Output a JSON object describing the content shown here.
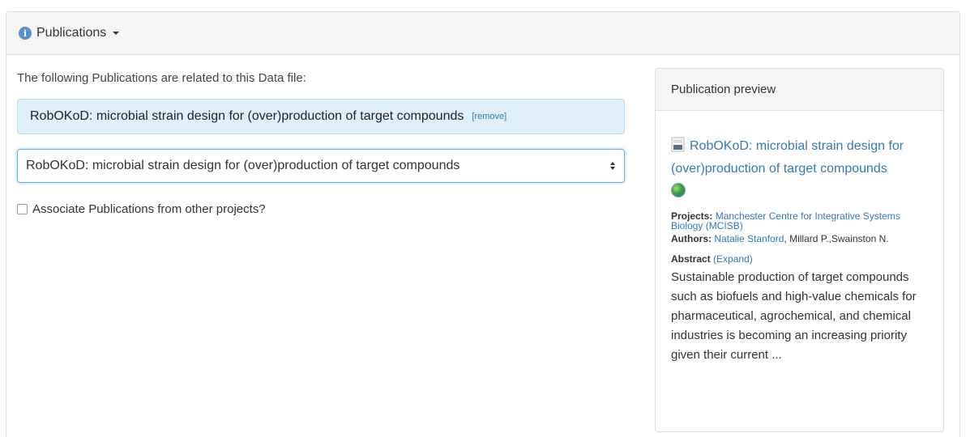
{
  "panel": {
    "title": "Publications"
  },
  "intro_text": "The following Publications are related to this Data file:",
  "selected_publication": {
    "title": "RobOKoD: microbial strain design for (over)production of target compounds",
    "remove_label": "[remove]"
  },
  "publication_select": {
    "value": "RobOKoD: microbial strain design for (over)production of target compounds"
  },
  "associate_checkbox": {
    "label": "Associate Publications from other projects?",
    "checked": false
  },
  "preview": {
    "heading": "Publication preview",
    "title": "RobOKoD: microbial strain design for (over)production of target compounds",
    "projects_label": "Projects:",
    "projects_value": "Manchester Centre for Integrative Systems Biology (MCISB)",
    "authors_label": "Authors:",
    "author_link": "Natalie Stanford",
    "authors_rest": ", Millard P.,Swainston N.",
    "abstract_label": "Abstract",
    "expand_label": "(Expand)",
    "abstract_text": "Sustainable production of target compounds such as biofuels and high-value chemicals for pharmaceutical, agrochemical, and chemical industries is becoming an increasing priority given their current ..."
  },
  "icons": {
    "info": "info-icon",
    "dropdown": "caret-down-icon",
    "document": "document-icon",
    "globe": "globe-icon",
    "select": "select-arrows-icon"
  },
  "colors": {
    "link": "#337ab7",
    "selected_bg": "#dff0fb",
    "focus_border": "#66afe9",
    "heading_bg": "#f5f5f5"
  }
}
